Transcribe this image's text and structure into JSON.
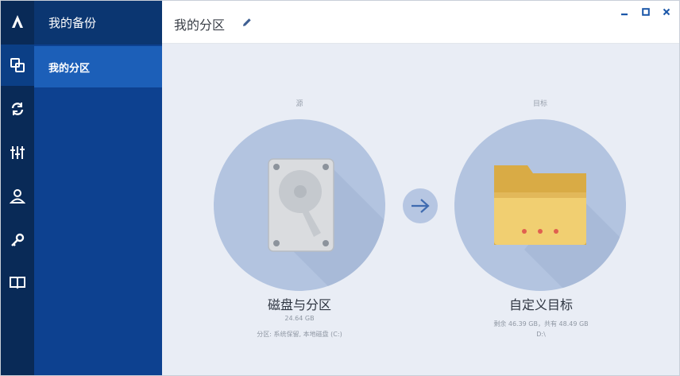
{
  "sidebar": {
    "rail": [
      {
        "icon": "acronis-logo-icon"
      },
      {
        "icon": "backup-copies-icon",
        "active": true
      },
      {
        "icon": "sync-icon"
      },
      {
        "icon": "tools-icon"
      },
      {
        "icon": "account-icon"
      },
      {
        "icon": "key-icon"
      },
      {
        "icon": "book-icon"
      }
    ],
    "header": "我的备份",
    "items": [
      {
        "label": "我的分区",
        "active": true
      }
    ]
  },
  "titlebar": {
    "title": "我的分区"
  },
  "source": {
    "section_label": "源",
    "title": "磁盘与分区",
    "size": "24.64 GB",
    "detail": "分区: 系统保留, 本地磁盘 (C:)"
  },
  "destination": {
    "section_label": "目标",
    "title": "自定义目标",
    "detail_line1": "剩余 46.39 GB，共有 48.49 GB",
    "detail_line2": "D:\\"
  },
  "colors": {
    "rail": "#092a57",
    "nav": "#0d4190",
    "nav_active": "#1c5fb8",
    "main_bg": "#e9edf5",
    "circle": "#b3c4e0",
    "folder": "#eec766"
  }
}
